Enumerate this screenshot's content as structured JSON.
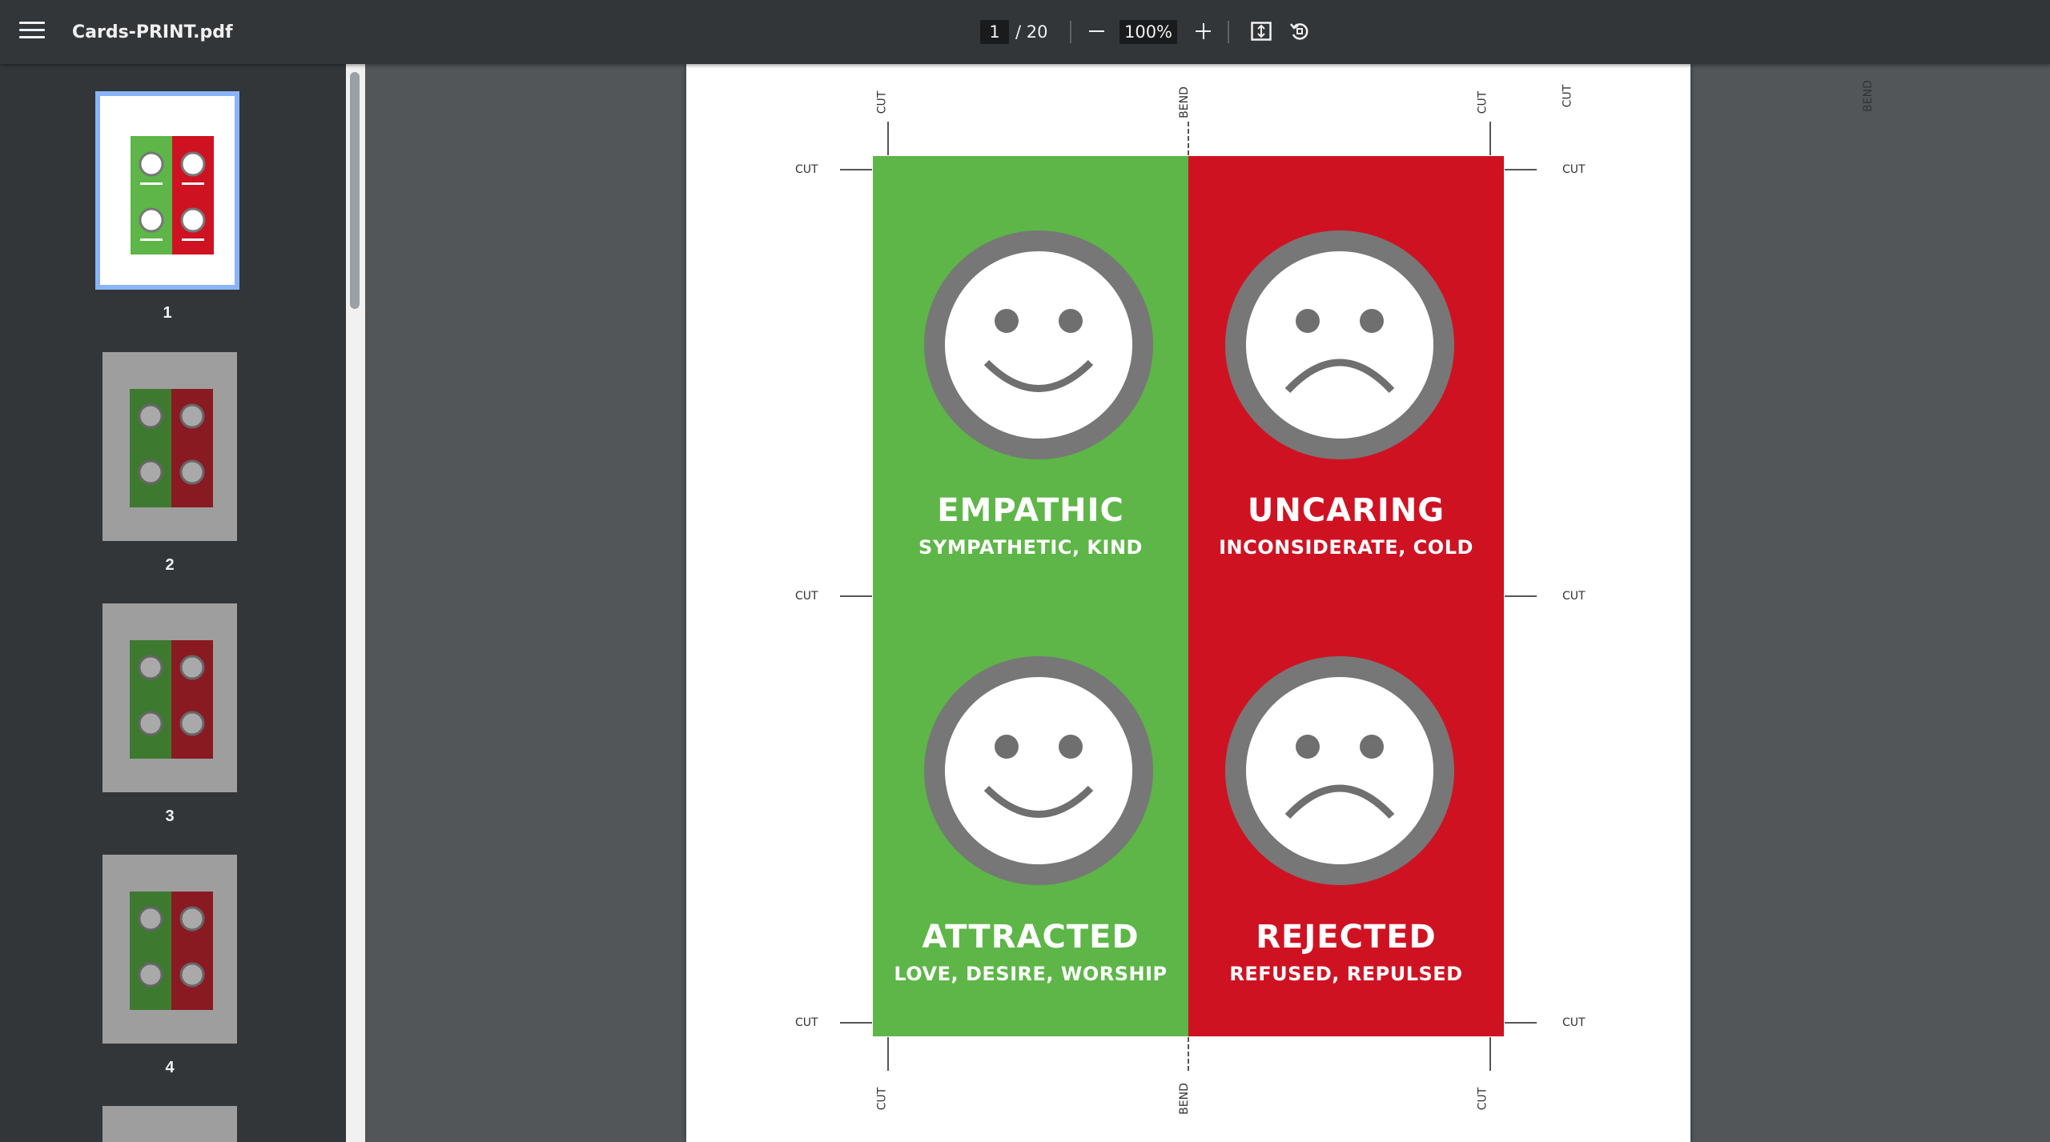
{
  "toolbar": {
    "title": "Cards-PRINT.pdf",
    "page_current": "1",
    "page_total": "/ 20",
    "zoom": "100%"
  },
  "sidebar": {
    "thumbnails": [
      {
        "label": "1",
        "selected": true
      },
      {
        "label": "2",
        "selected": false
      },
      {
        "label": "3",
        "selected": false
      },
      {
        "label": "4",
        "selected": false
      }
    ]
  },
  "document": {
    "marks": {
      "cut": "CUT",
      "bend": "BEND"
    },
    "cards": [
      {
        "title": "EMPATHIC",
        "subtitle": "SYMPATHETIC, KIND",
        "face": "smile"
      },
      {
        "title": "UNCARING",
        "subtitle": "INCONSIDERATE, COLD",
        "face": "frown"
      },
      {
        "title": "ATTRACTED",
        "subtitle": "LOVE, DESIRE, WORSHIP",
        "face": "smile"
      },
      {
        "title": "REJECTED",
        "subtitle": "REFUSED, REPULSED",
        "face": "frown"
      }
    ]
  },
  "colors": {
    "green": "#5db647",
    "red": "#cf1222",
    "face_ring": "#777777",
    "selected_thumb": "#8ab4f8"
  }
}
